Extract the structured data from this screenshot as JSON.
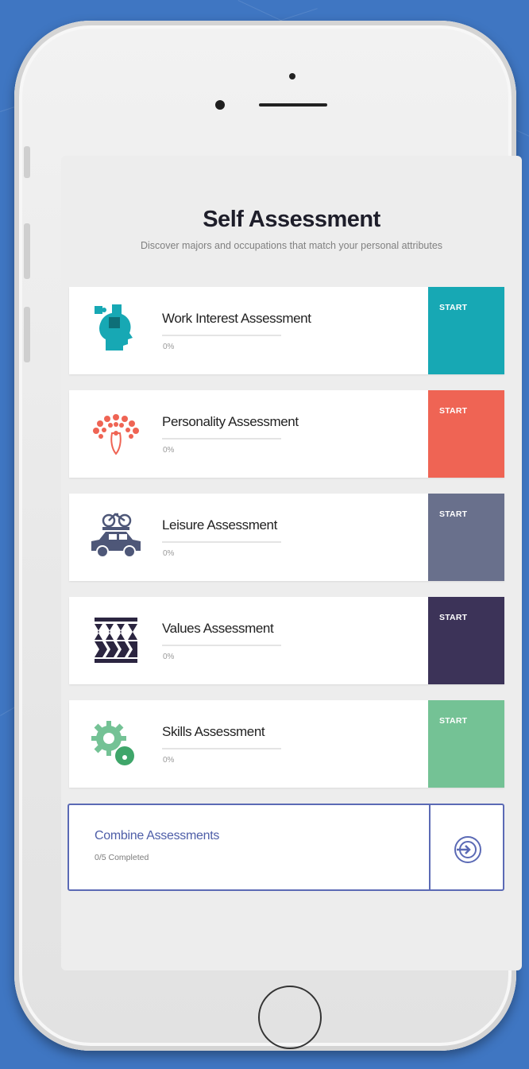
{
  "header": {
    "title": "Self Assessment",
    "subtitle": "Discover majors and occupations that match your personal attributes"
  },
  "assessments": [
    {
      "name": "Work Interest Assessment",
      "progress": "0%",
      "progress_value": 0,
      "action": "START",
      "color": "#17a8b4",
      "icon": "head-puzzle-icon"
    },
    {
      "name": "Personality Assessment",
      "progress": "0%",
      "progress_value": 0,
      "action": "START",
      "color": "#ef6454",
      "icon": "peacock-icon"
    },
    {
      "name": "Leisure Assessment",
      "progress": "0%",
      "progress_value": 0,
      "action": "START",
      "color": "#69708c",
      "icon": "car-bike-icon"
    },
    {
      "name": "Values Assessment",
      "progress": "0%",
      "progress_value": 0,
      "action": "START",
      "color": "#3c3358",
      "icon": "arrows-pattern-icon"
    },
    {
      "name": "Skills Assessment",
      "progress": "0%",
      "progress_value": 0,
      "action": "START",
      "color": "#74c295",
      "icon": "gears-icon"
    }
  ],
  "combine": {
    "name": "Combine Assessments",
    "status": "0/5 Completed",
    "icon": "merge-circle-icon",
    "color": "#5b6ab5"
  }
}
